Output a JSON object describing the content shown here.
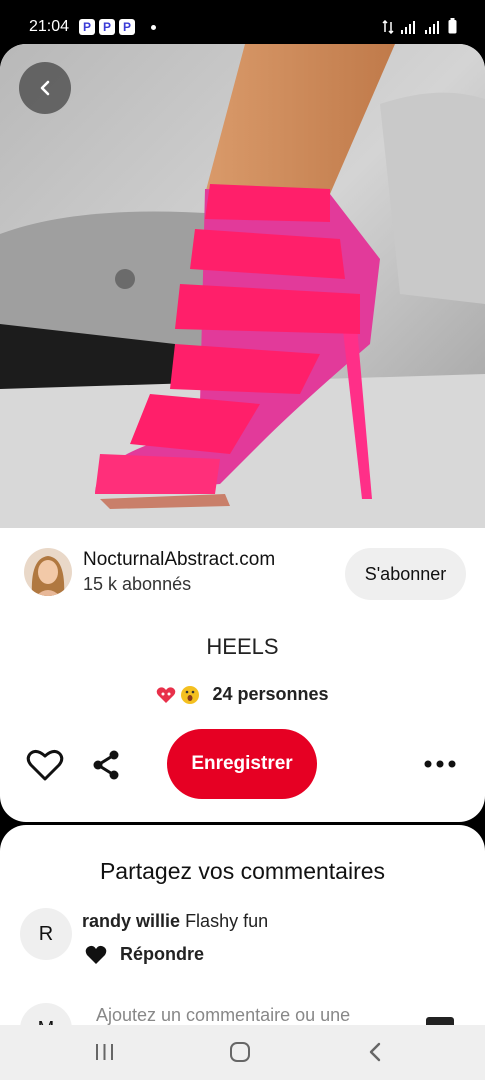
{
  "status_bar": {
    "time": "21:04",
    "app_badges": [
      "P",
      "P",
      "P"
    ]
  },
  "pin": {
    "image_description_icon": "pink-strappy-heel-photo",
    "author": {
      "name": "NocturnalAbstract.com",
      "followers": "15 k abonnés"
    },
    "follow_label": "S'abonner",
    "title": "HEELS",
    "reactions": {
      "text": "24 personnes",
      "icons": [
        "heart-eyes-icon",
        "wow-face-icon"
      ]
    },
    "save_label": "Enregistrer"
  },
  "comments": {
    "title": "Partagez vos commentaires",
    "items": [
      {
        "avatar_letter": "R",
        "user": "randy willie",
        "text": "Flashy fun",
        "reply_label": "Répondre"
      }
    ],
    "input_placeholder": "Ajoutez un commentaire ou une",
    "my_avatar_letter": "M"
  },
  "colors": {
    "accent": "#e60023",
    "shoe_pink": "#ff1f7a",
    "button_gray": "#efefef"
  }
}
